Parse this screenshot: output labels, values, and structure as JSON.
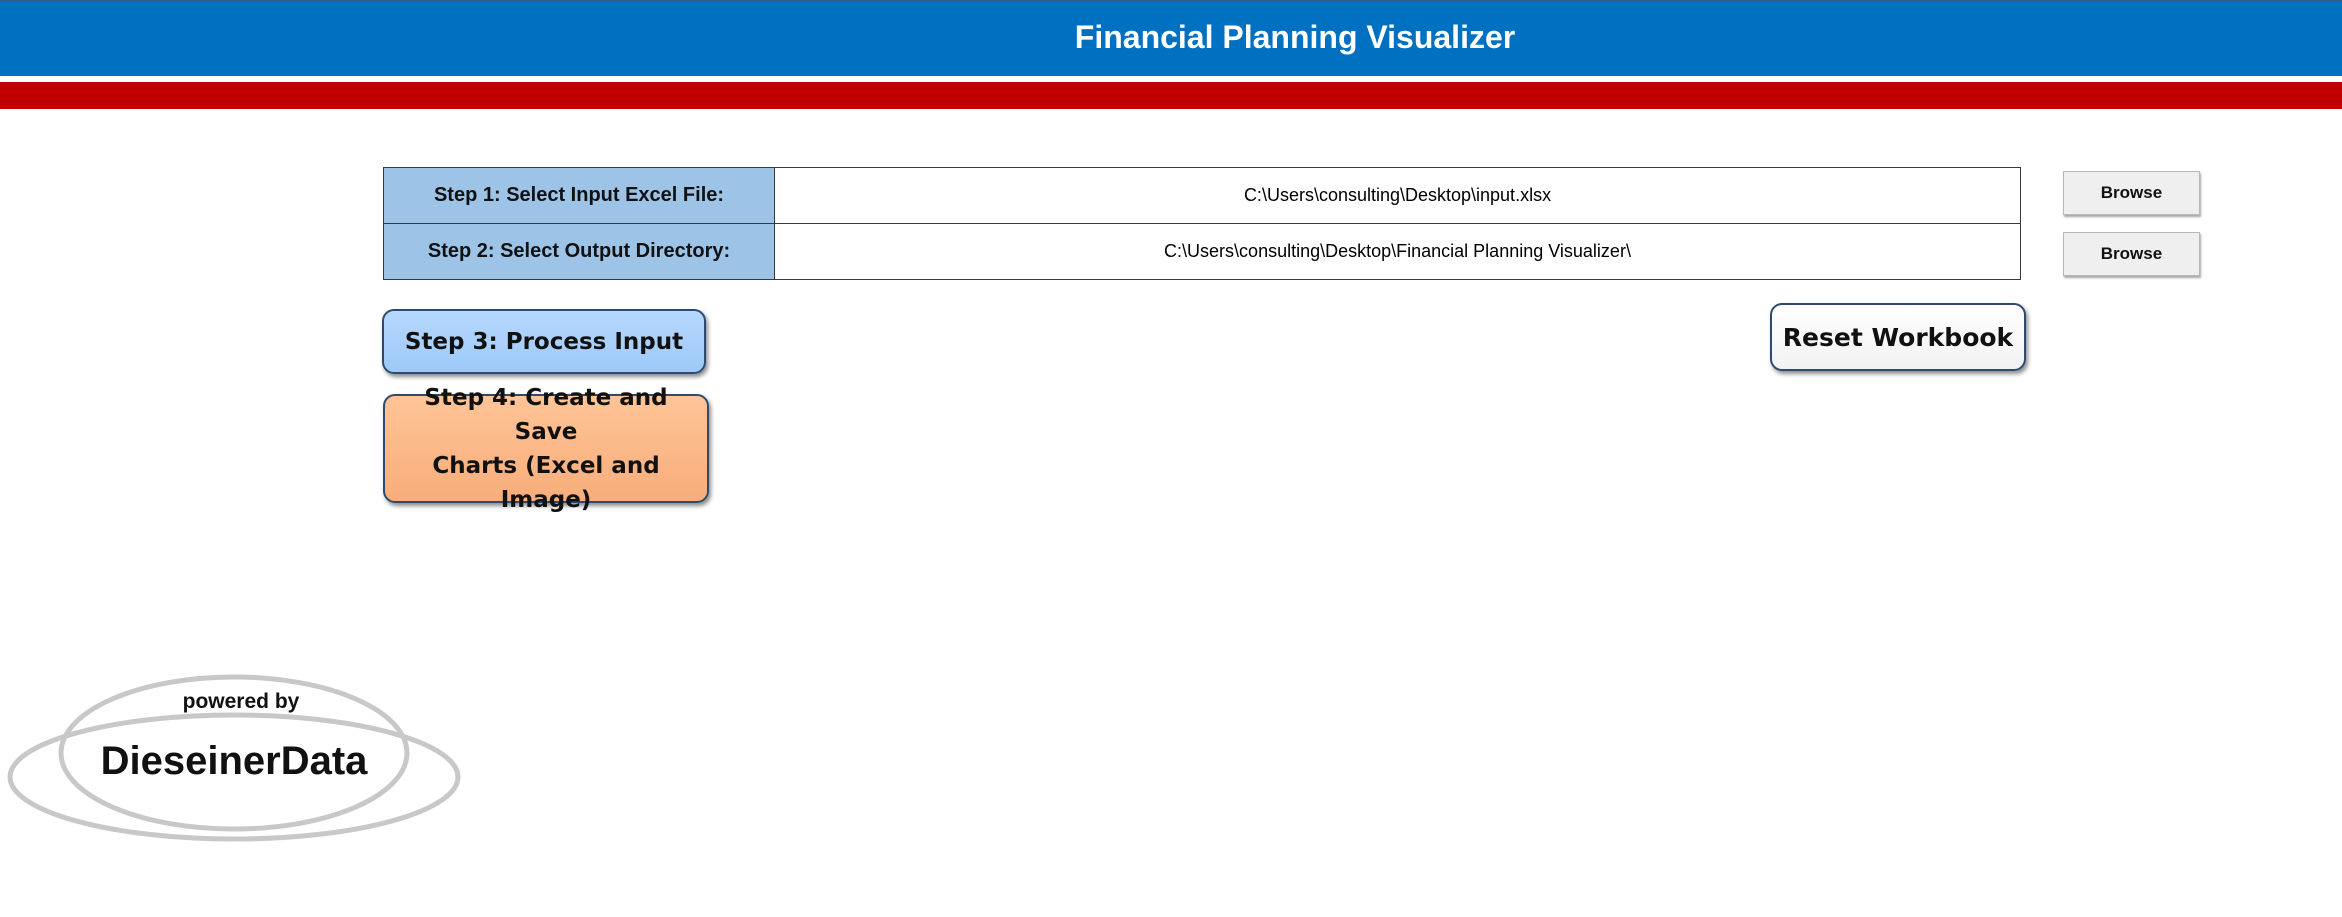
{
  "header": {
    "title": "Financial Planning Visualizer",
    "colors": {
      "title_bar": "#0070C0",
      "accent_bar": "#C00000"
    }
  },
  "steps": [
    {
      "label": "Step 1: Select Input Excel File:",
      "value": "C:\\Users\\consulting\\Desktop\\input.xlsx",
      "browse_label": "Browse"
    },
    {
      "label": "Step 2: Select Output Directory:",
      "value": "C:\\Users\\consulting\\Desktop\\Financial Planning Visualizer\\",
      "browse_label": "Browse"
    }
  ],
  "buttons": {
    "process_input": "Step 3: Process Input",
    "create_charts_line1": "Step 4: Create and Save",
    "create_charts_line2": "Charts (Excel and Image)",
    "reset_workbook": "Reset Workbook"
  },
  "logo": {
    "powered_by": "powered by",
    "brand": "DieseinerData"
  }
}
